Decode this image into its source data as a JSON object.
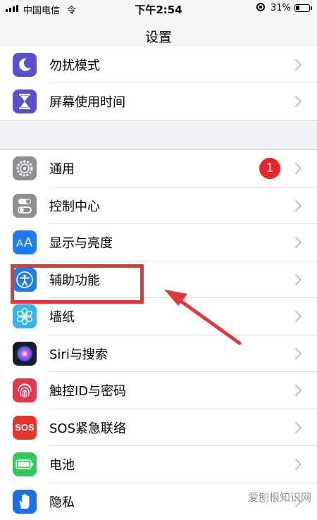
{
  "status_bar": {
    "carrier": "中国电信",
    "wifi": "令",
    "time": "下午2:54",
    "battery_percent": "31%",
    "battery_level": 0.31
  },
  "nav": {
    "title": "设置"
  },
  "group_a": [
    {
      "label": "勿扰模式",
      "icon": "moon-icon",
      "color": "#5a4fd0"
    },
    {
      "label": "屏幕使用时间",
      "icon": "hourglass-icon",
      "color": "#5a4fd0"
    }
  ],
  "group_b": [
    {
      "label": "通用",
      "icon": "gear-icon",
      "color": "#8e8e93",
      "badge": "1"
    },
    {
      "label": "控制中心",
      "icon": "toggles-icon",
      "color": "#8e8e93"
    },
    {
      "label": "显示与亮度",
      "icon": "text-size-icon",
      "color": "#1b7cf5"
    },
    {
      "label": "辅助功能",
      "icon": "accessibility-icon",
      "color": "#1b7cf5"
    },
    {
      "label": "墙纸",
      "icon": "flower-icon",
      "color": "#35b7e6"
    },
    {
      "label": "Siri与搜索",
      "icon": "siri-icon",
      "color": "#1a1a2e"
    },
    {
      "label": "触控ID与密码",
      "icon": "fingerprint-icon",
      "color": "#e8344f"
    },
    {
      "label": "SOS紧急联络",
      "icon": "sos-icon",
      "color": "#e8342f",
      "icon_text": "SOS"
    },
    {
      "label": "电池",
      "icon": "battery-icon",
      "color": "#34c759"
    },
    {
      "label": "隐私",
      "icon": "hand-icon",
      "color": "#1b6de8"
    }
  ],
  "annotation": {
    "highlight_color": "#e0383a"
  },
  "watermark": "爱刨根知识网"
}
